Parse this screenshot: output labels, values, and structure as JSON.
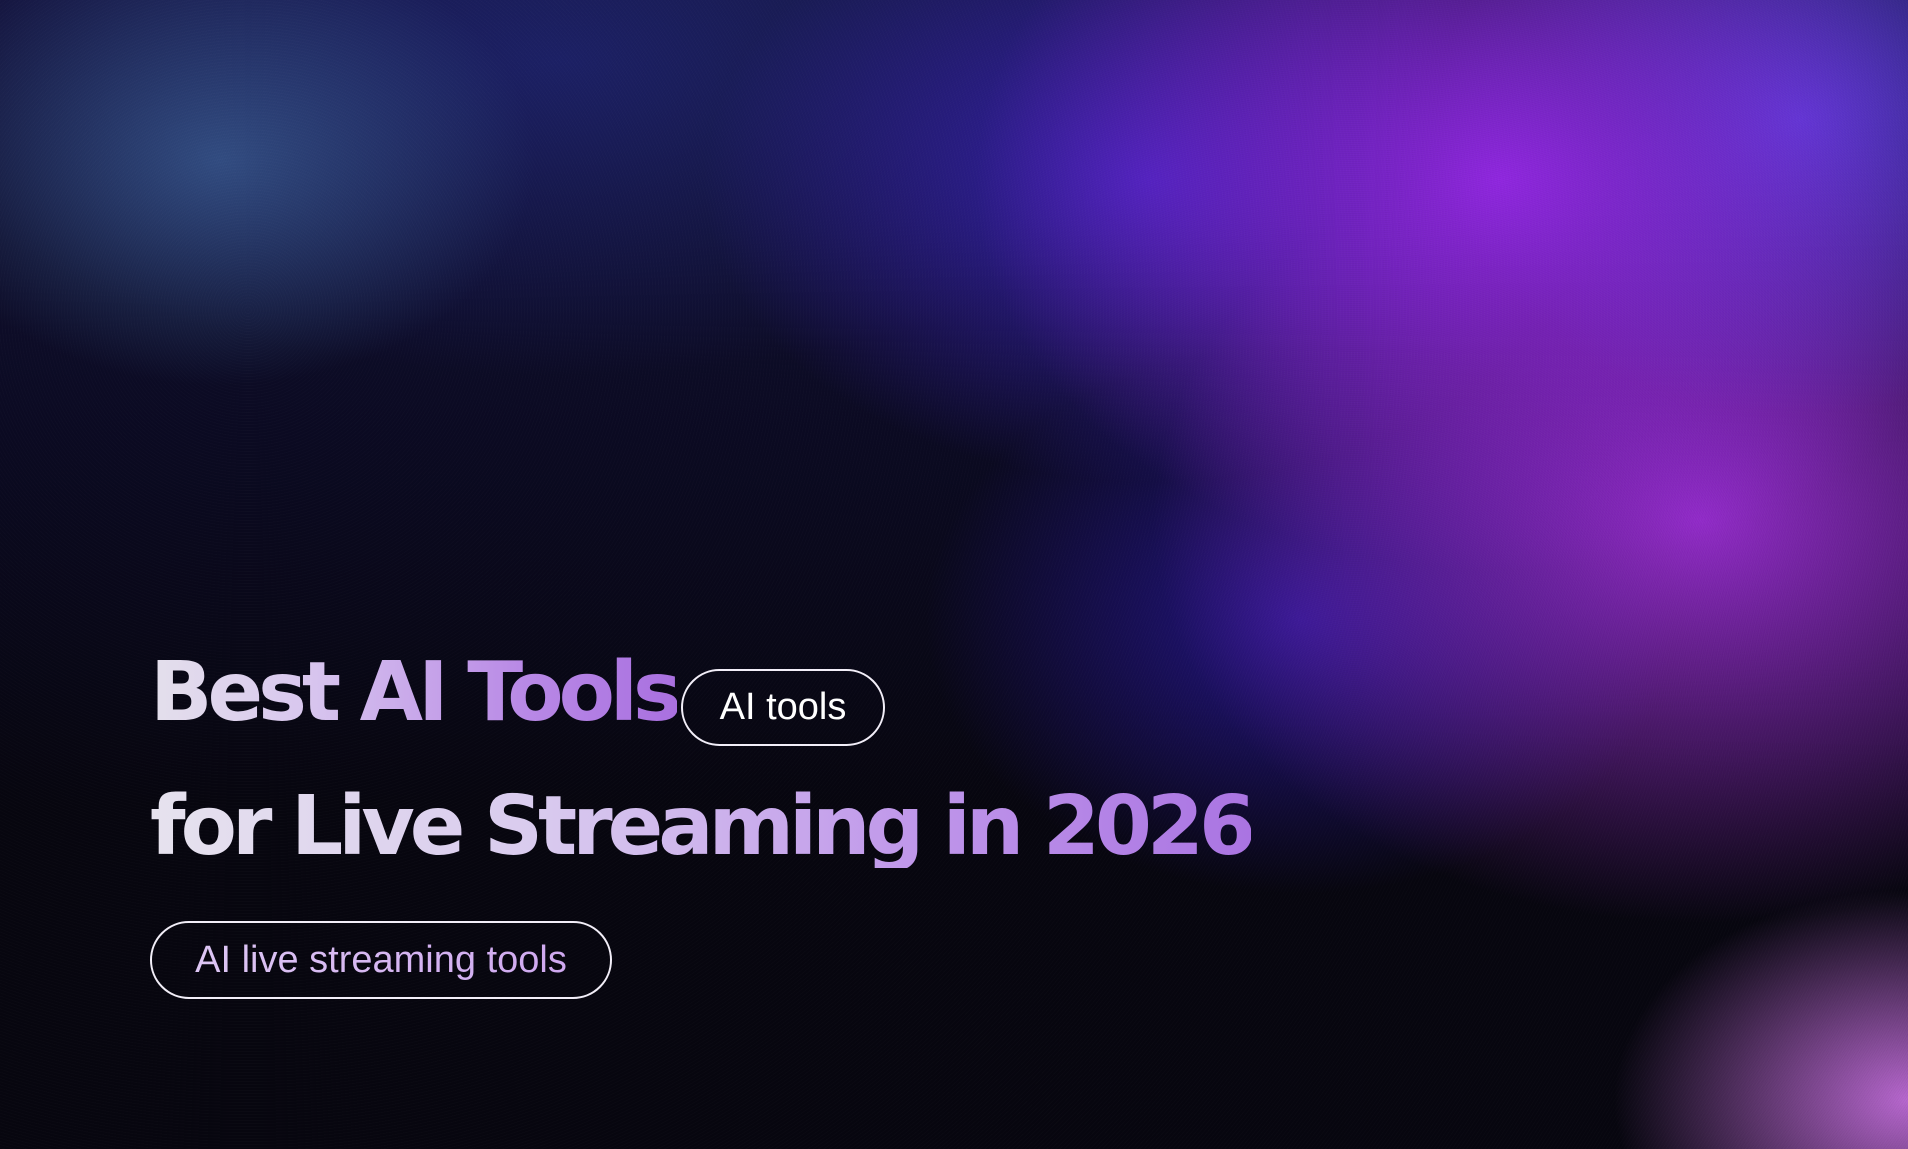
{
  "hero": {
    "title_line1": "Best AI Tools",
    "title_line2": "for Live Streaming in 2026",
    "tag_primary": "AI tools",
    "tag_secondary": "AI live streaming tools"
  },
  "colors": {
    "background_dark": "#07060f",
    "glow_purple": "#9628e6",
    "glow_blue": "#3c23be",
    "glow_pink": "#d678f0",
    "title_light": "#e4e0ec",
    "title_violet": "#a970e0",
    "pill_border": "#f2eef8"
  }
}
